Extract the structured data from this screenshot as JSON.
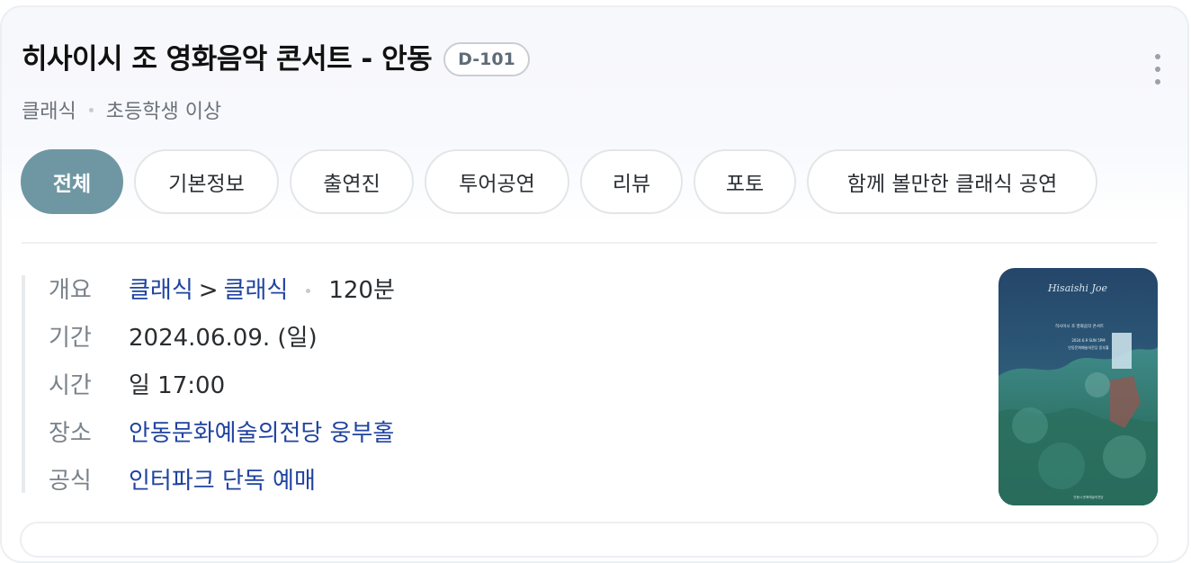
{
  "header": {
    "title": "히사이시 조 영화음악 콘서트 - 안동",
    "dday": "D-101",
    "genre": "클래식",
    "age": "초등학생 이상"
  },
  "tabs": [
    {
      "label": "전체",
      "active": true
    },
    {
      "label": "기본정보",
      "active": false
    },
    {
      "label": "출연진",
      "active": false
    },
    {
      "label": "투어공연",
      "active": false
    },
    {
      "label": "리뷰",
      "active": false
    },
    {
      "label": "포토",
      "active": false
    },
    {
      "label": "함께 볼만한 클래식 공연",
      "active": false
    }
  ],
  "info": {
    "overview": {
      "label": "개요",
      "category": "클래식",
      "arrow": ">",
      "subcategory": "클래식",
      "runtime": "120분"
    },
    "period": {
      "label": "기간",
      "value": "2024.06.09. (일)"
    },
    "time": {
      "label": "시간",
      "value": "일 17:00"
    },
    "venue": {
      "label": "장소",
      "value": "안동문화예술의전당 웅부홀"
    },
    "official": {
      "label": "공식",
      "value": "인터파크 단독 예매"
    }
  },
  "poster": {
    "script_title": "Hisaishi Joe",
    "line1": "히사이시 조 영화음악 콘서트",
    "line2": "2024.6.9 SUN 5PM",
    "line3": "안동문화예술의전당 웅부홀",
    "footer": "안동시·문화예술의전당"
  },
  "colors": {
    "accent_tab": "#6f97a3",
    "link": "#1f43a0"
  }
}
